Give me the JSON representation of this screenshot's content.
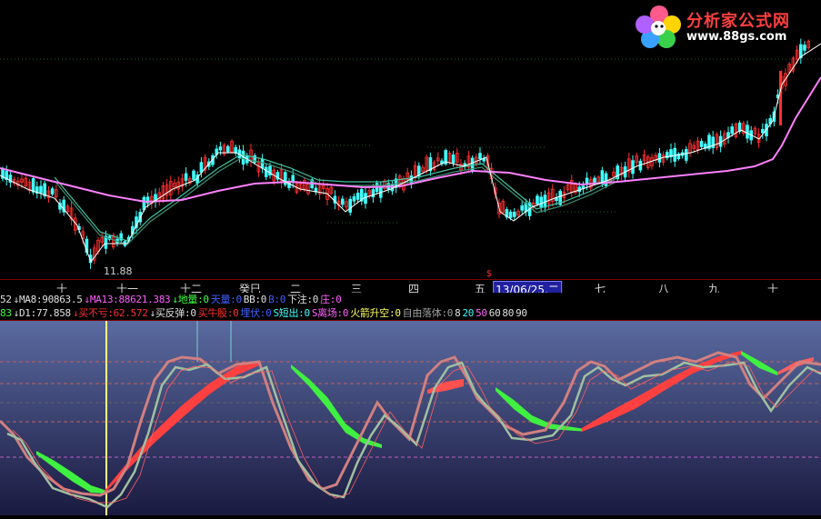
{
  "logo": {
    "brand": "分析家公式网",
    "url": "www.88gs.com"
  },
  "price_chart": {
    "low_label": "11.88"
  },
  "time_axis": {
    "labels": [
      "十",
      "十一",
      "十二",
      "癸巳",
      "二",
      "三",
      "四",
      "五",
      "13/06/25,二",
      "七",
      "八",
      "九",
      "十"
    ],
    "marker": "$"
  },
  "info_row_1": [
    {
      "text": "52",
      "color": "white"
    },
    {
      "text": "↓MA8:90863.5",
      "color": "white"
    },
    {
      "text": "↓MA13:88621.383",
      "color": "magenta"
    },
    {
      "text": "↓地量:0",
      "color": "green"
    },
    {
      "text": "天量:0",
      "color": "blue"
    },
    {
      "text": "BB:0",
      "color": "white"
    },
    {
      "text": "B:0",
      "color": "blue"
    },
    {
      "text": "下注:0",
      "color": "white"
    },
    {
      "text": "庄:0",
      "color": "magenta"
    }
  ],
  "info_row_2": [
    {
      "text": "83",
      "color": "green"
    },
    {
      "text": "↓D1:77.858",
      "color": "white"
    },
    {
      "text": "↓买不亏:62.572",
      "color": "red"
    },
    {
      "text": "↓买反弹:0",
      "color": "white"
    },
    {
      "text": "买牛股:0",
      "color": "red"
    },
    {
      "text": "埋伏:0",
      "color": "blue"
    },
    {
      "text": "S短出:0",
      "color": "cyan"
    },
    {
      "text": "S离场:0",
      "color": "magenta"
    },
    {
      "text": "火箭升空:0",
      "color": "yellow"
    },
    {
      "text": "自由落体:0",
      "color": "gray"
    },
    {
      "text": "8",
      "color": "white"
    },
    {
      "text": "20",
      "color": "cyan"
    },
    {
      "text": "50",
      "color": "magenta"
    },
    {
      "text": "60",
      "color": "white"
    },
    {
      "text": "80",
      "color": "white"
    },
    {
      "text": "90",
      "color": "white"
    }
  ],
  "chart_data": [
    {
      "type": "candlestick",
      "title": "",
      "annotations": [
        "11.88"
      ],
      "series": [
        {
          "name": "MA8",
          "values": [
            90863.5
          ]
        },
        {
          "name": "MA13",
          "values": [
            88621.383
          ]
        }
      ],
      "colors": {
        "up": "#ff3030",
        "down": "#40ffff",
        "long_ma": "#ff80ff",
        "short_ma": "#ffffff",
        "band": "#40c0a0"
      }
    },
    {
      "type": "line",
      "title": "",
      "series": [
        {
          "name": "D1",
          "values": [
            77.858
          ]
        },
        {
          "name": "买不亏",
          "values": [
            62.572
          ]
        }
      ],
      "reference_lines": [
        8,
        20,
        50,
        60,
        80,
        90
      ],
      "colors": {
        "band_up": "#ff4040",
        "band_down": "#40f040",
        "rsi": "#d08080",
        "fast": "#a0c0a0"
      }
    }
  ],
  "colors": {
    "background": "#000000",
    "axis": "#7a0000",
    "panel_top": "#5a6aa0",
    "panel_bottom": "#1a1a40"
  }
}
